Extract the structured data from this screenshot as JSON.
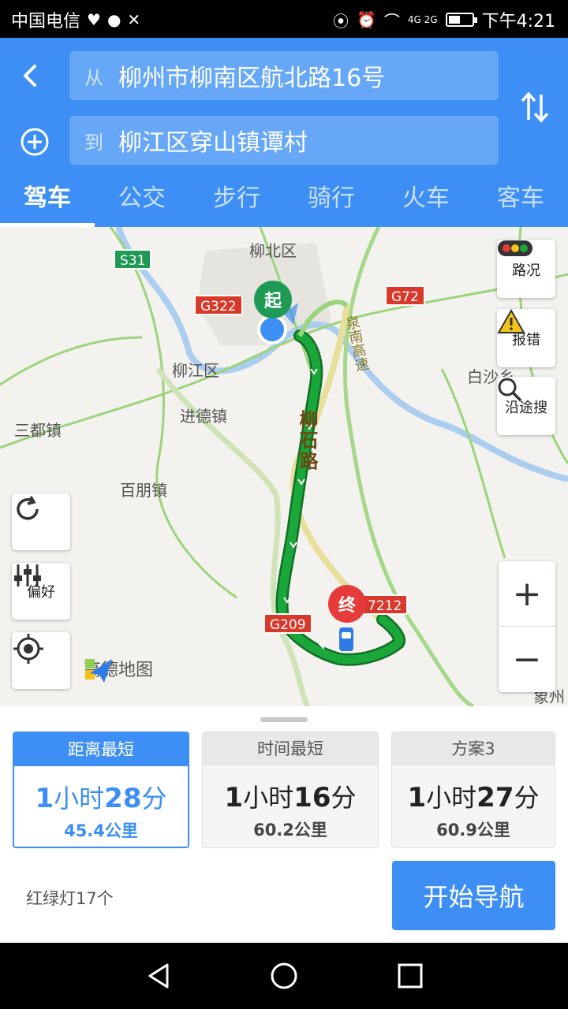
{
  "status_bar": {
    "carrier": "中国电信",
    "network": "4G 2G",
    "time": "下午4:21",
    "battery_level": 0.5
  },
  "route_search": {
    "from_prefix": "从",
    "from_value": "柳州市柳南区航北路16号",
    "to_prefix": "到",
    "to_value": "柳江区穿山镇谭村"
  },
  "tabs": [
    {
      "label": "驾车",
      "active": true
    },
    {
      "label": "公交"
    },
    {
      "label": "步行"
    },
    {
      "label": "骑行"
    },
    {
      "label": "火车"
    },
    {
      "label": "客车"
    }
  ],
  "map": {
    "labels": {
      "liubei": "柳北区",
      "liujiang": "柳江区",
      "jinde": "进德镇",
      "sandu": "三都镇",
      "baipeng": "百朋镇",
      "baisha": "白沙乡",
      "xiangzhou": "象州"
    },
    "road_labels": {
      "liushi": "柳石路",
      "quannan": "泉南高速"
    },
    "badges": {
      "s31": "S31",
      "g322": "G322",
      "g72": "G72",
      "g209": "G209",
      "g7212": "7212"
    },
    "start_pin": "起",
    "end_pin": "终",
    "brand": "高德地图",
    "buttons": {
      "traffic": "路况",
      "report": "报错",
      "along_search": "沿途搜",
      "preference": "偏好"
    }
  },
  "plans": [
    {
      "title": "距离最短",
      "hours": "1",
      "h_unit": "小时",
      "minutes": "28",
      "m_unit": "分",
      "distance": "45.4公里",
      "active": true
    },
    {
      "title": "时间最短",
      "hours": "1",
      "h_unit": "小时",
      "minutes": "16",
      "m_unit": "分",
      "distance": "60.2公里"
    },
    {
      "title": "方案3",
      "hours": "1",
      "h_unit": "小时",
      "minutes": "27",
      "m_unit": "分",
      "distance": "60.9公里"
    }
  ],
  "traffic_lights": "红绿灯17个",
  "start_nav": "开始导航",
  "colors": {
    "accent": "#3d8ff5",
    "route": "#1aa83a",
    "start": "#1f9a55",
    "end": "#e63b3b"
  }
}
